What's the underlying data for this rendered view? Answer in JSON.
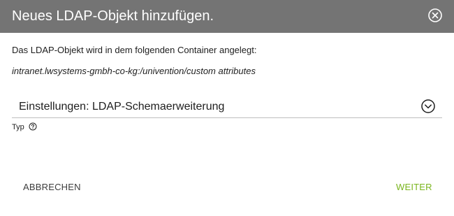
{
  "dialog": {
    "title": "Neues LDAP-Objekt hinzufügen.",
    "close_icon": "close-circle-icon"
  },
  "body": {
    "container_label": "Das LDAP-Objekt wird in dem folgenden Container angelegt:",
    "container_path": "intranet.lwsystems-gmbh-co-kg:/univention/custom attributes"
  },
  "type_select": {
    "value": "Einstellungen: LDAP-Schemaerweiterung",
    "label": "Typ",
    "dropdown_icon": "chevron-down-circle-icon",
    "help_icon": "help-circle-icon"
  },
  "footer": {
    "cancel_label": "ABBRECHEN",
    "next_label": "WEITER"
  },
  "colors": {
    "titlebar": "#747474",
    "accent": "#7ab51d",
    "text": "#1e1e1e"
  }
}
